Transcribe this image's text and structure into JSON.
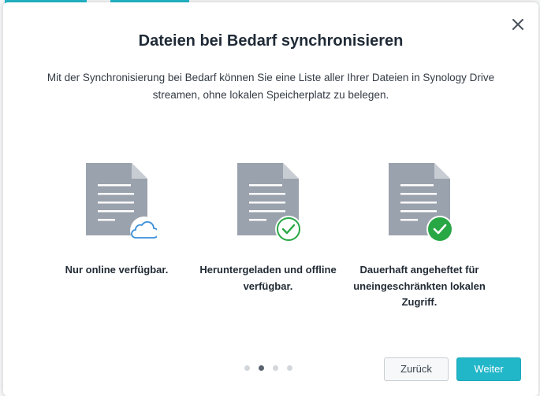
{
  "dialog": {
    "title": "Dateien bei Bedarf synchronisieren",
    "description": "Mit der Synchronisierung bei Bedarf können Sie eine Liste aller Ihrer Dateien in Synology Drive streamen, ohne lokalen Speicherplatz zu belegen.",
    "close_icon": "close-icon"
  },
  "features": [
    {
      "label": "Nur online verfügbar.",
      "icon": "document-cloud-icon"
    },
    {
      "label": "Heruntergeladen und offline verfügbar.",
      "icon": "document-check-outline-icon"
    },
    {
      "label": "Dauerhaft angeheftet für uneingeschränkten lokalen Zugriff.",
      "icon": "document-check-filled-icon"
    }
  ],
  "pagination": {
    "total": 4,
    "current": 2
  },
  "buttons": {
    "back_label": "Zurück",
    "next_label": "Weiter"
  },
  "colors": {
    "accent": "#21b6c8",
    "document": "#9aa2ad",
    "cloud": "#3a8fd9",
    "check": "#28a745"
  }
}
